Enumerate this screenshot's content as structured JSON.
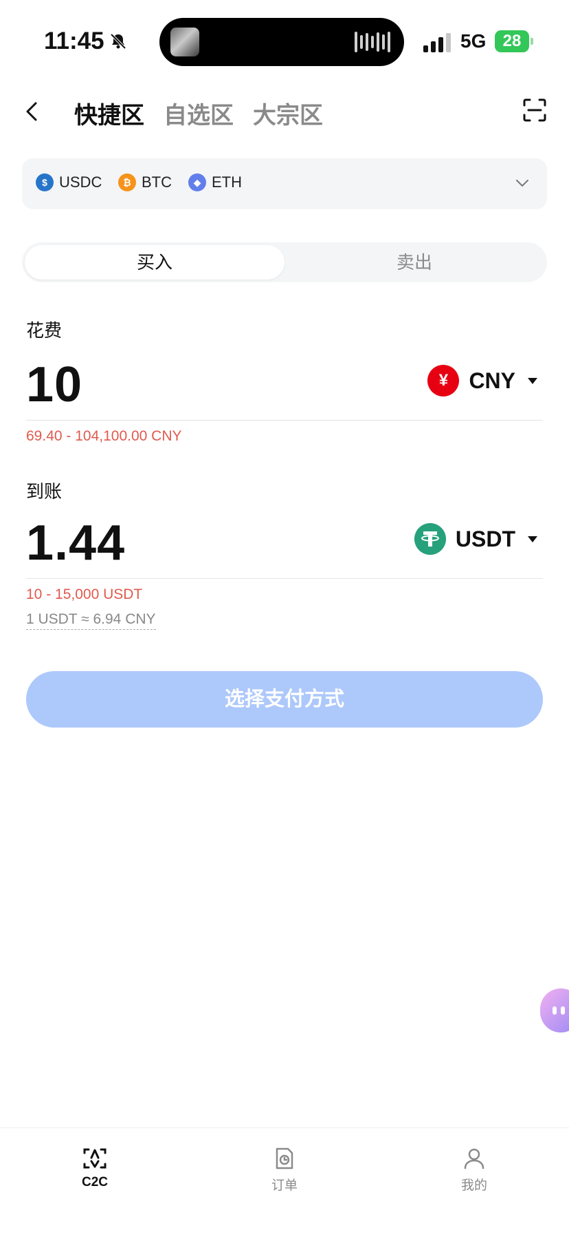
{
  "status_bar": {
    "time": "11:45",
    "network": "5G",
    "battery": "28"
  },
  "header": {
    "tabs": [
      {
        "label": "快捷区",
        "active": true
      },
      {
        "label": "自选区",
        "active": false
      },
      {
        "label": "大宗区",
        "active": false
      }
    ]
  },
  "coin_filter": {
    "coins": [
      {
        "symbol": "USDC",
        "icon": "usdc-icon",
        "color": "#2775ca"
      },
      {
        "symbol": "BTC",
        "icon": "btc-icon",
        "color": "#f7931a"
      },
      {
        "symbol": "ETH",
        "icon": "eth-icon",
        "color": "#627eea"
      }
    ]
  },
  "trade_toggle": {
    "buy": "买入",
    "sell": "卖出",
    "selected": "买入"
  },
  "spend": {
    "label": "花费",
    "amount": "10",
    "currency": "CNY",
    "currency_symbol": "¥",
    "range": "69.40 - 104,100.00 CNY"
  },
  "receive": {
    "label": "到账",
    "amount": "1.44",
    "currency": "USDT",
    "range": "10 - 15,000 USDT",
    "rate": "1 USDT ≈ 6.94 CNY"
  },
  "cta": {
    "label": "选择支付方式"
  },
  "bottom_nav": [
    {
      "label": "C2C",
      "icon": "c2c-icon",
      "active": true
    },
    {
      "label": "订单",
      "icon": "orders-icon",
      "active": false
    },
    {
      "label": "我的",
      "icon": "profile-icon",
      "active": false
    }
  ],
  "colors": {
    "accent_disabled": "#adc8fb",
    "error": "#e05a4e",
    "cny_red": "#e60012",
    "usdt_green": "#26a17b"
  }
}
